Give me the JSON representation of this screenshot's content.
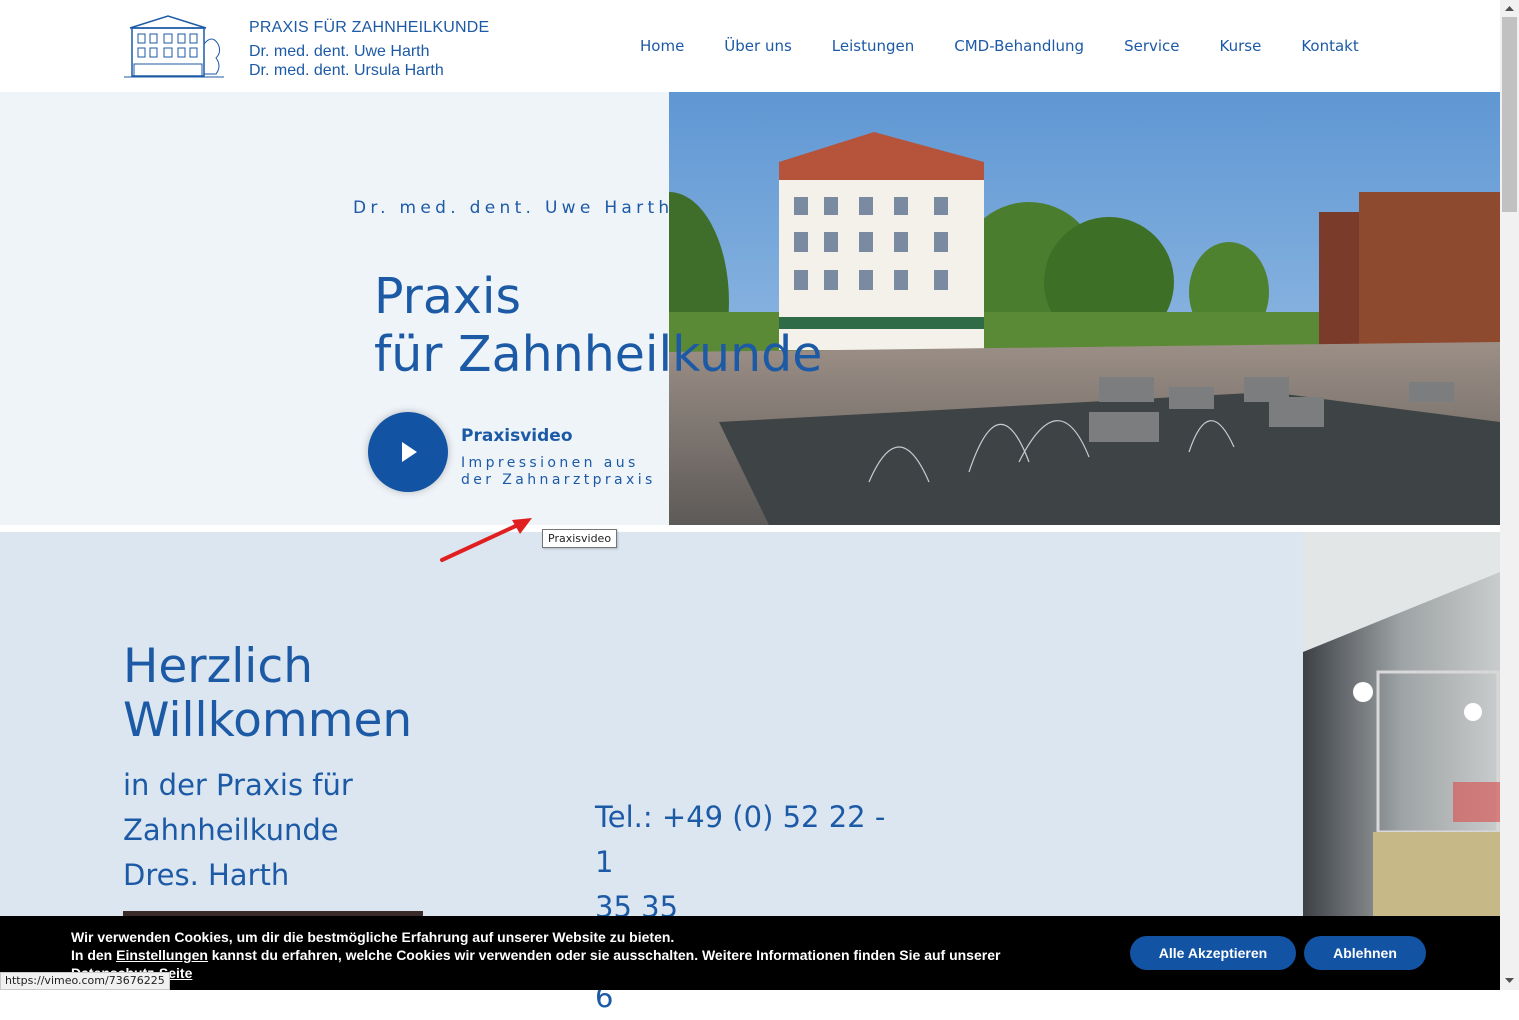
{
  "header": {
    "brand_title": "PRAXIS FÜR ZAHNHEILKUNDE",
    "brand_line1": "Dr. med. dent. Uwe Harth",
    "brand_line2": "Dr. med. dent. Ursula Harth",
    "nav": [
      {
        "label": "Home"
      },
      {
        "label": "Über uns"
      },
      {
        "label": "Leistungen"
      },
      {
        "label": "CMD-Behandlung"
      },
      {
        "label": "Service"
      },
      {
        "label": "Kurse"
      },
      {
        "label": "Kontakt"
      }
    ]
  },
  "hero": {
    "subtitle": "Dr. med. dent. Uwe Harth",
    "title_line1": "Praxis",
    "title_line2": "für Zahnheilkunde",
    "video_title": "Praxisvideo",
    "video_desc_line1": "Impressionen aus",
    "video_desc_line2": "der Zahnarztpraxis",
    "tooltip": "Praxisvideo"
  },
  "welcome": {
    "heading_line1": "Herzlich",
    "heading_line2": "Willkommen",
    "sub_line1": "in der Praxis für",
    "sub_line2": "Zahnheilkunde",
    "sub_line3": "Dres. Harth",
    "tel_line1": "Tel.: +49 (0) 52 22 - 1",
    "tel_line2": "35 35",
    "fax": "Fax: +49 (0) 52 22 - 6"
  },
  "cookie": {
    "text_line1": "Wir verwenden Cookies, um dir die bestmögliche Erfahrung auf unserer Website zu bieten.",
    "text_pre_link": "In den ",
    "settings_link": "Einstellungen",
    "text_mid": " kannst du erfahren, welche Cookies wir verwenden oder sie ausschalten. Weitere Informationen finden Sie auf unserer ",
    "privacy_link": "Datenschutz-Seite",
    "accept_label": "Alle Akzeptieren",
    "decline_label": "Ablehnen"
  },
  "status_bar": {
    "url": "https://vimeo.com/73676225"
  },
  "colors": {
    "brand_blue": "#1d5aa6",
    "button_blue": "#1253a3",
    "hero_bg": "#eff4f9",
    "welcome_bg": "#dce6f1"
  }
}
